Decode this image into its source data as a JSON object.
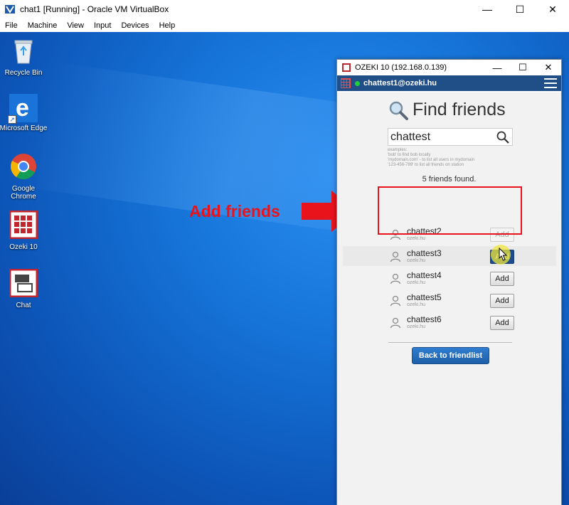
{
  "host": {
    "title": "chat1 [Running] - Oracle VM VirtualBox",
    "menu": [
      "File",
      "Machine",
      "View",
      "Input",
      "Devices",
      "Help"
    ],
    "controls": {
      "minimize": "—",
      "maximize": "☐",
      "close": "✕"
    }
  },
  "desktop": {
    "icons": [
      {
        "label": "Recycle Bin"
      },
      {
        "label": "Microsoft Edge"
      },
      {
        "label": "Google Chrome"
      },
      {
        "label": "Ozeki 10"
      },
      {
        "label": "Chat"
      }
    ]
  },
  "annotation": {
    "text": "Add friends",
    "color": "#e8131b"
  },
  "ozeki": {
    "title": "OZEKI 10 (192.168.0.139)",
    "controls": {
      "minimize": "—",
      "maximize": "☐",
      "close": "✕"
    },
    "user": "chattest1@ozeki.hu",
    "heading": "Find friends",
    "search_value": "chattest",
    "examples": [
      "examples:",
      "'bob' to find bob locally",
      "'mydomain.com' - to list all users in mydomain",
      "'123-456-789' to list all friends on station"
    ],
    "found_text": "5 friends found.",
    "friends": [
      {
        "name": "chattest2",
        "domain": "ozeki.hu",
        "add": "Add",
        "state": "disabled"
      },
      {
        "name": "chattest3",
        "domain": "ozeki.hu",
        "add": "Add",
        "state": "hover"
      },
      {
        "name": "chattest4",
        "domain": "ozeki.hu",
        "add": "Add",
        "state": "normal"
      },
      {
        "name": "chattest5",
        "domain": "ozeki.hu",
        "add": "Add",
        "state": "normal"
      },
      {
        "name": "chattest6",
        "domain": "ozeki.hu",
        "add": "Add",
        "state": "normal"
      }
    ],
    "back_label": "Back to friendlist",
    "colors": {
      "bar": "#1f4f86",
      "back_button": "#2f7dd0",
      "online": "#1fcf3a"
    }
  }
}
